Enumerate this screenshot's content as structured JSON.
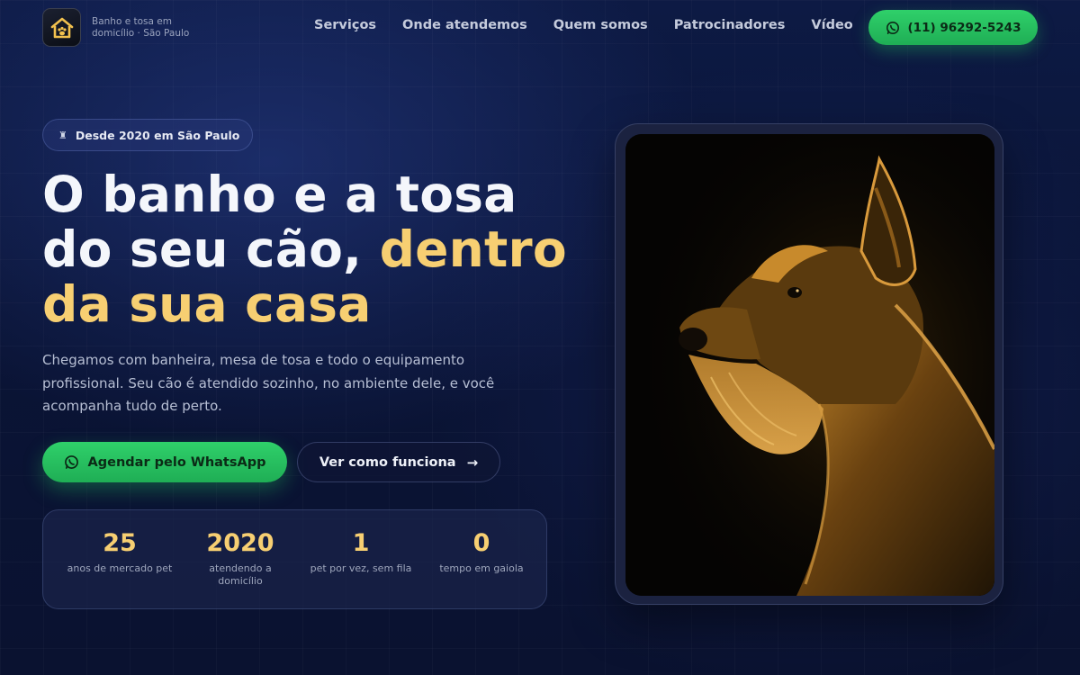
{
  "header": {
    "brand_text": "Banho e tosa em domicílio · São Paulo",
    "nav": [
      "Serviços",
      "Onde atendemos",
      "Quem somos",
      "Patrocinadores",
      "Vídeo"
    ],
    "phone_label": "(11) 96292-5243"
  },
  "hero": {
    "badge_icon": "dog-icon",
    "badge": "Desde 2020 em São Paulo",
    "title_part1": "O banho e a tosa do seu cão, ",
    "title_highlight": "dentro da sua casa",
    "subtitle": "Chegamos com banheira, mesa de tosa e todo o equipamento profissional. Seu cão é atendido sozinho, no ambiente dele, e você acompanha tudo de perto.",
    "cta_primary": "Agendar pelo WhatsApp",
    "cta_secondary": "Ver como funciona",
    "cta_secondary_arrow": "→"
  },
  "stats": [
    {
      "value": "25",
      "label": "anos de mercado pet"
    },
    {
      "value": "2020",
      "label": "atendendo a domicílio"
    },
    {
      "value": "1",
      "label": "pet por vez, sem fila"
    },
    {
      "value": "0",
      "label": "tempo em gaiola"
    }
  ],
  "colors": {
    "accent_gold": "#f7cf72",
    "whatsapp_green": "#22c55e",
    "background": "#0a1436"
  }
}
